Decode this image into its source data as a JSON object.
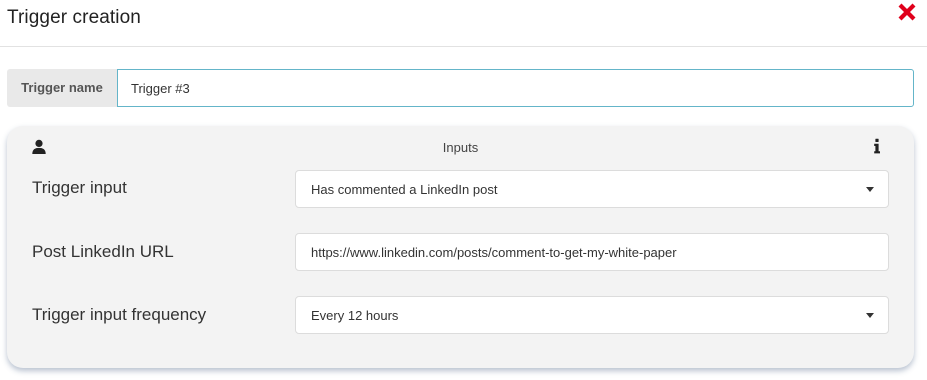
{
  "dialog": {
    "title": "Trigger creation",
    "close_icon": "close-icon",
    "close_color": "#e0001b"
  },
  "trigger_name": {
    "label": "Trigger name",
    "value": "Trigger #3"
  },
  "inputs_card": {
    "title": "Inputs",
    "left_icon": "user-icon",
    "right_icon": "info-icon",
    "fields": [
      {
        "label": "Trigger input",
        "type": "select",
        "value": "Has commented a LinkedIn post"
      },
      {
        "label": "Post LinkedIn URL",
        "type": "text",
        "value": "https://www.linkedin.com/posts/comment-to-get-my-white-paper"
      },
      {
        "label": "Trigger input frequency",
        "type": "select",
        "value": "Every 12 hours"
      }
    ]
  }
}
